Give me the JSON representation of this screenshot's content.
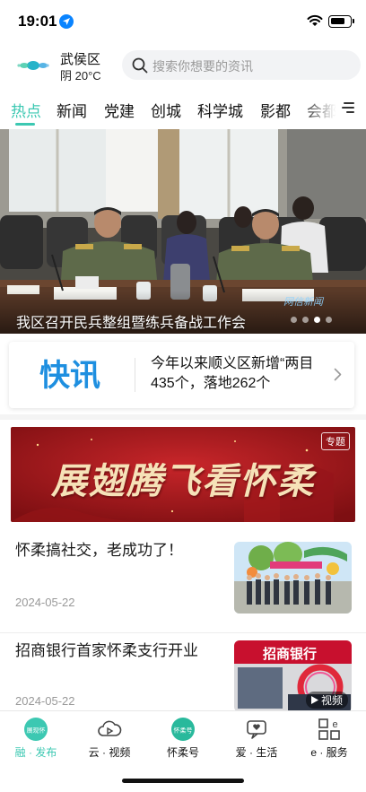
{
  "status_bar": {
    "time": "19:01"
  },
  "header": {
    "city": "武侯区",
    "weather": "阴 20°C",
    "search_placeholder": "搜索你想要的资讯"
  },
  "tabs": [
    "热点",
    "新闻",
    "党建",
    "创城",
    "科学城",
    "影都",
    "会都"
  ],
  "active_tab": "热点",
  "hero": {
    "caption": "我区召开民兵整组暨练兵备战工作会",
    "watermark": "网信新闻",
    "slide_count": 4,
    "active_slide": 3
  },
  "flash": {
    "logo_text": "快讯",
    "text": "今年以来顺义区新增“两目435个，落地262个"
  },
  "banner": {
    "title": "展翅腾飞看怀柔",
    "badge": "专题"
  },
  "news": [
    {
      "title": "怀柔搞社交，老成功了！",
      "date": "2024-05-22",
      "video": ""
    },
    {
      "title": "招商银行首家怀柔支行开业",
      "date": "2024-05-22",
      "video": "视频",
      "thumb_sign": "招商银行"
    }
  ],
  "bottom_nav": [
    {
      "label": "融 · 发布",
      "icon_text": "展现怀",
      "icon": "publish-icon"
    },
    {
      "label": "云 · 视频",
      "icon": "cloud-video-icon"
    },
    {
      "label": "怀柔号",
      "icon_text": "怀柔号",
      "icon": "huairou-account-icon"
    },
    {
      "label": "爱 · 生活",
      "icon": "life-icon"
    },
    {
      "label": "e · 服务",
      "icon": "service-grid-icon"
    }
  ],
  "colors": {
    "accent": "#3cc8b2",
    "banner_red": "#a8171a"
  }
}
